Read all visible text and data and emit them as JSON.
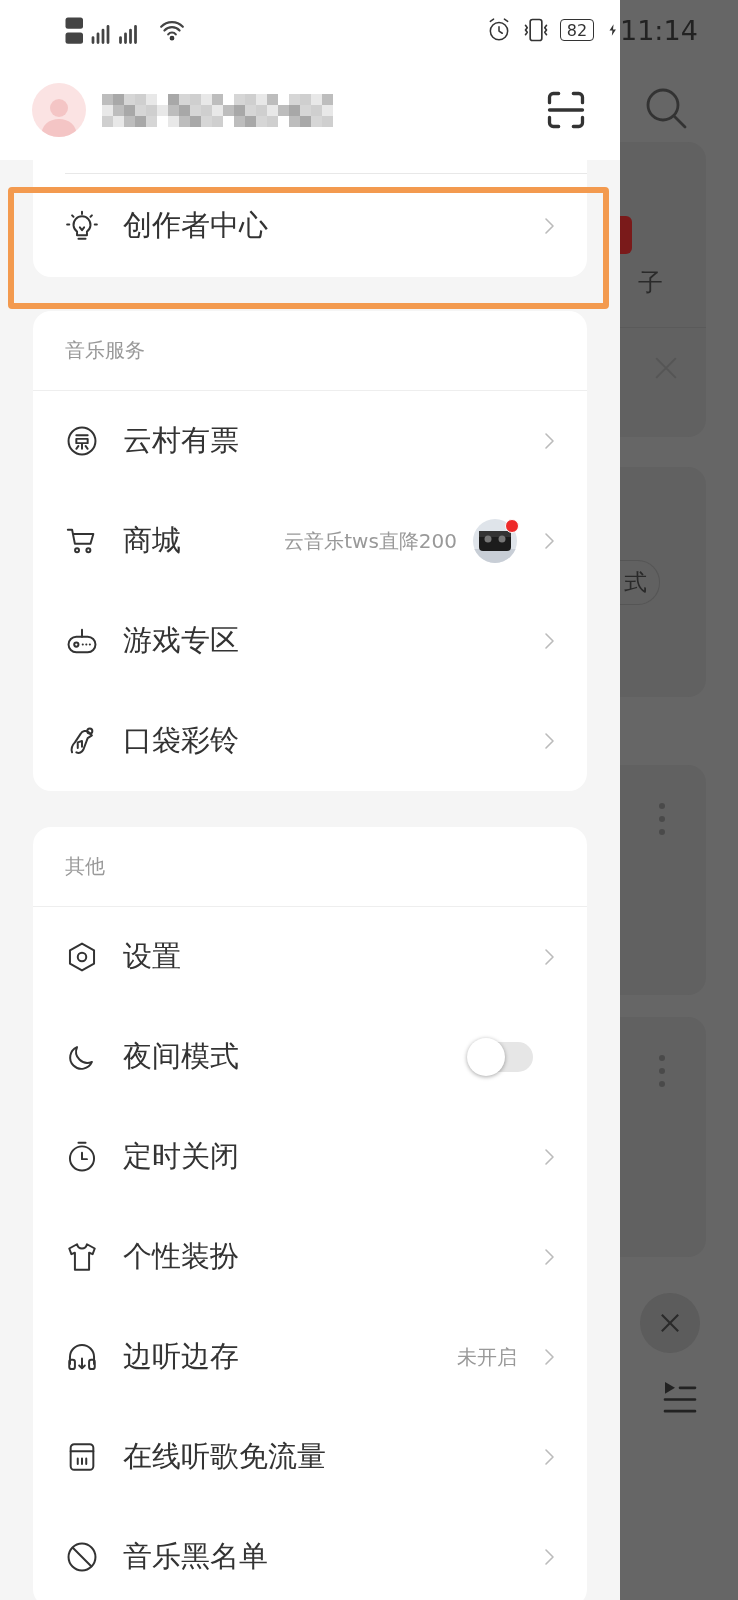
{
  "status_bar": {
    "battery": "82",
    "time": "11:14"
  },
  "creator_card": {
    "label": "创作者中心"
  },
  "sections": [
    {
      "title": "音乐服务",
      "rows": [
        {
          "kind": "link",
          "label": "云村有票"
        },
        {
          "kind": "link",
          "label": "商城",
          "value": "云音乐tws直降200",
          "thumbnail": {
            "badge": true
          }
        },
        {
          "kind": "link",
          "label": "游戏专区"
        },
        {
          "kind": "link",
          "label": "口袋彩铃"
        }
      ]
    },
    {
      "title": "其他",
      "rows": [
        {
          "kind": "link",
          "label": "设置"
        },
        {
          "kind": "toggle",
          "label": "夜间模式",
          "on": false
        },
        {
          "kind": "link",
          "label": "定时关闭"
        },
        {
          "kind": "link",
          "label": "个性装扮"
        },
        {
          "kind": "link",
          "label": "边听边存",
          "value": "未开启"
        },
        {
          "kind": "link",
          "label": "在线听歌免流量"
        },
        {
          "kind": "link",
          "label": "音乐黑名单"
        }
      ]
    }
  ],
  "background_app": {
    "text_1": "子",
    "pill": "式"
  }
}
